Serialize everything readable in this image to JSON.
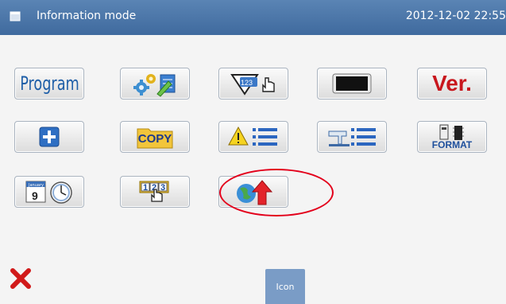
{
  "titlebar": {
    "title": "Information mode",
    "datetime": "2012-12-02  22:55"
  },
  "buttons": {
    "program_label": "Program",
    "ver_label": "Ver.",
    "copy_label": "COPY",
    "format_label": "FORMAT",
    "counter_digits": [
      "1",
      "2",
      "3"
    ],
    "calendar_month": "January",
    "calendar_day": "9",
    "dial_text": "123"
  },
  "footer": {
    "icon_tab_label": "Icon"
  },
  "colors": {
    "title_bar": "#4b77ab",
    "ver_red": "#c8161d",
    "program_blue": "#1f5fa8",
    "highlight_red": "#e3001b"
  }
}
